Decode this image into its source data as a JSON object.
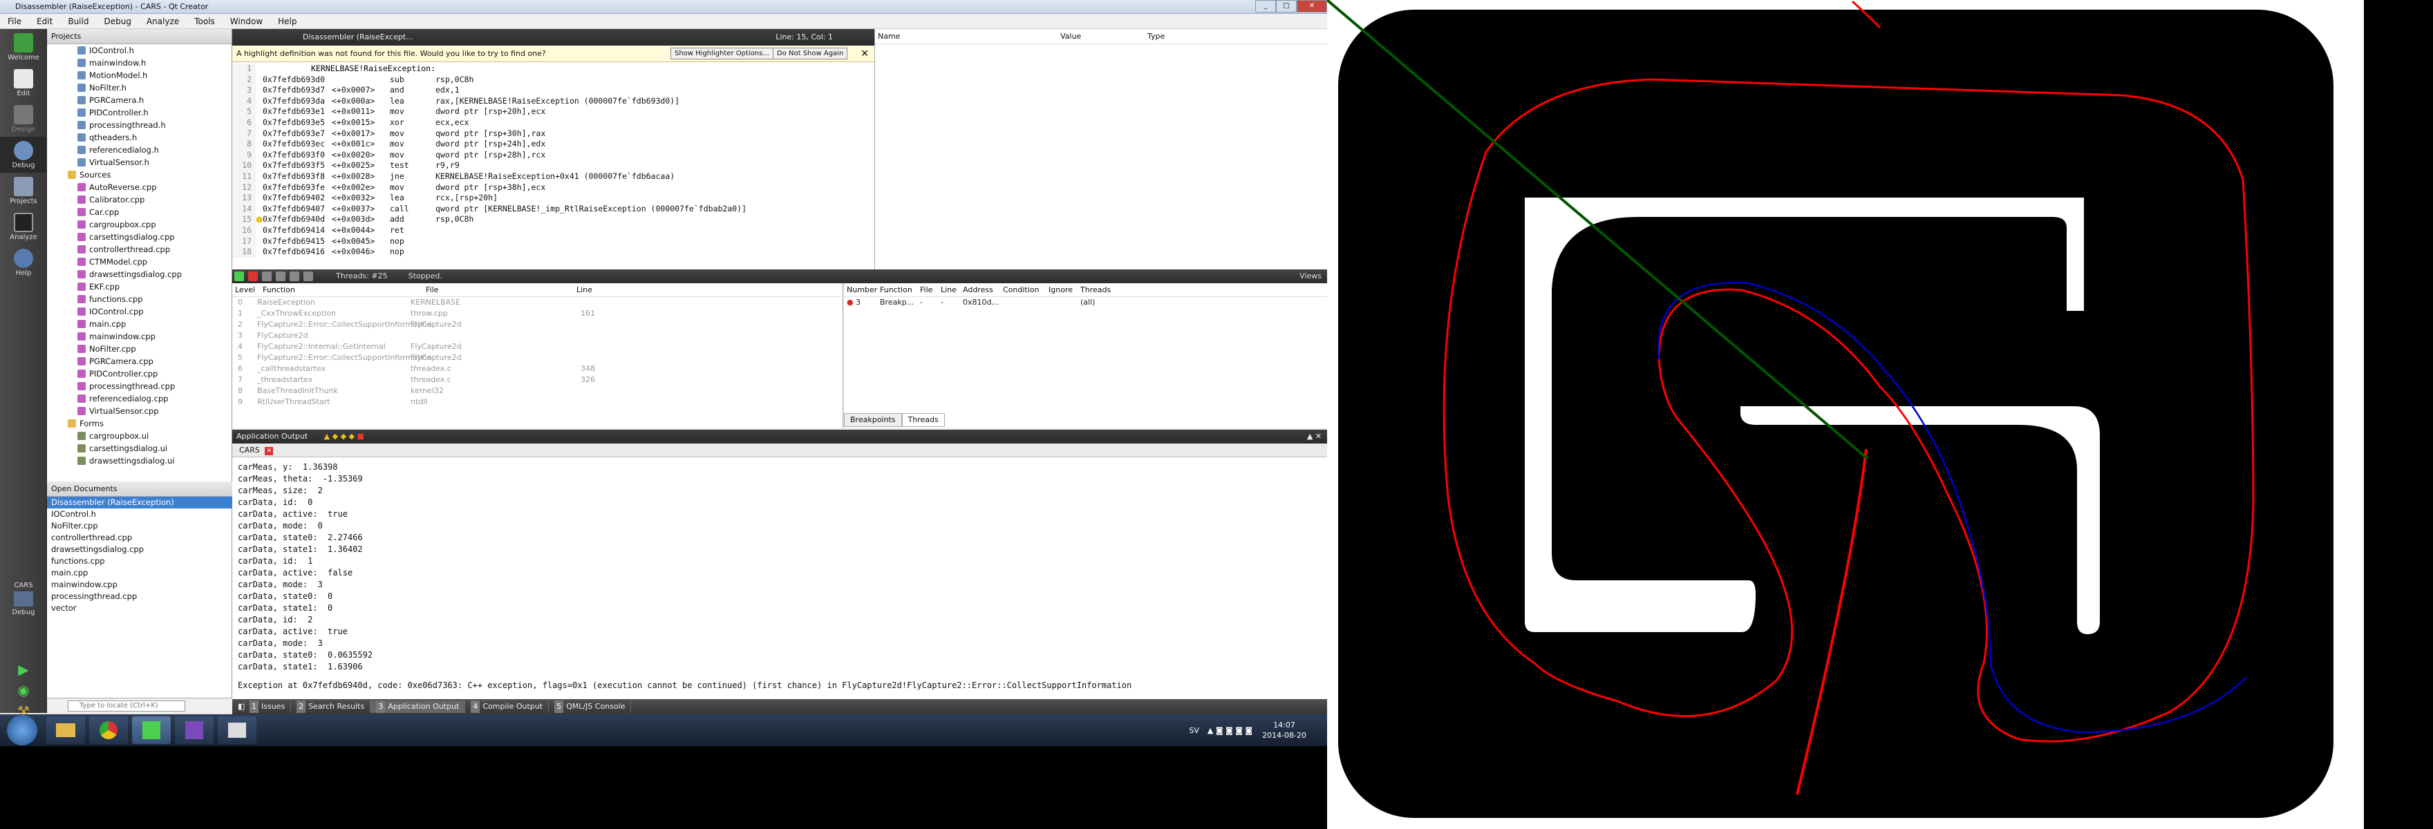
{
  "window": {
    "title": "Disassembler (RaiseException) - CARS - Qt Creator"
  },
  "menu": [
    "File",
    "Edit",
    "Build",
    "Debug",
    "Analyze",
    "Tools",
    "Window",
    "Help"
  ],
  "modes": [
    "Welcome",
    "Edit",
    "Design",
    "Debug",
    "Projects",
    "Analyze",
    "Help"
  ],
  "run_target": {
    "project": "CARS",
    "mode": "Debug"
  },
  "projects_panel": {
    "title": "Projects",
    "tree": [
      {
        "name": "IOControl.h",
        "kind": "h"
      },
      {
        "name": "mainwindow.h",
        "kind": "h"
      },
      {
        "name": "MotionModel.h",
        "kind": "h"
      },
      {
        "name": "NoFilter.h",
        "kind": "h"
      },
      {
        "name": "PGRCamera.h",
        "kind": "h"
      },
      {
        "name": "PIDController.h",
        "kind": "h"
      },
      {
        "name": "processingthread.h",
        "kind": "h"
      },
      {
        "name": "qtheaders.h",
        "kind": "h"
      },
      {
        "name": "referencedialog.h",
        "kind": "h"
      },
      {
        "name": "VirtualSensor.h",
        "kind": "h"
      },
      {
        "name": "Sources",
        "kind": "folder"
      },
      {
        "name": "AutoReverse.cpp",
        "kind": "c"
      },
      {
        "name": "Calibrator.cpp",
        "kind": "c"
      },
      {
        "name": "Car.cpp",
        "kind": "c"
      },
      {
        "name": "cargroupbox.cpp",
        "kind": "c"
      },
      {
        "name": "carsettingsdialog.cpp",
        "kind": "c"
      },
      {
        "name": "controllerthread.cpp",
        "kind": "c"
      },
      {
        "name": "CTMModel.cpp",
        "kind": "c"
      },
      {
        "name": "drawsettingsdialog.cpp",
        "kind": "c"
      },
      {
        "name": "EKF.cpp",
        "kind": "c"
      },
      {
        "name": "functions.cpp",
        "kind": "c"
      },
      {
        "name": "IOControl.cpp",
        "kind": "c"
      },
      {
        "name": "main.cpp",
        "kind": "c"
      },
      {
        "name": "mainwindow.cpp",
        "kind": "c"
      },
      {
        "name": "NoFilter.cpp",
        "kind": "c"
      },
      {
        "name": "PGRCamera.cpp",
        "kind": "c"
      },
      {
        "name": "PIDController.cpp",
        "kind": "c"
      },
      {
        "name": "processingthread.cpp",
        "kind": "c"
      },
      {
        "name": "referencedialog.cpp",
        "kind": "c"
      },
      {
        "name": "VirtualSensor.cpp",
        "kind": "c"
      },
      {
        "name": "Forms",
        "kind": "folder"
      },
      {
        "name": "cargroupbox.ui",
        "kind": "u"
      },
      {
        "name": "carsettingsdialog.ui",
        "kind": "u"
      },
      {
        "name": "drawsettingsdialog.ui",
        "kind": "u"
      }
    ]
  },
  "open_documents": {
    "title": "Open Documents",
    "items": [
      "Disassembler (RaiseException)",
      "IOControl.h",
      "NoFilter.cpp",
      "controllerthread.cpp",
      "drawsettingsdialog.cpp",
      "functions.cpp",
      "main.cpp",
      "mainwindow.cpp",
      "processingthread.cpp",
      "vector"
    ]
  },
  "locator": {
    "placeholder": "Type to locate (Ctrl+K)"
  },
  "editor": {
    "doc": "Disassembler (RaiseExcept...",
    "cursor": "Line: 15, Col: 1",
    "highlight_msg": "A highlight definition was not found for this file. Would you like to try to find one?",
    "btn_show": "Show Highlighter Options...",
    "btn_no": "Do Not Show Again",
    "label_line": "KERNELBASE!RaiseException:",
    "lines": [
      {
        "n": "2",
        "addr": "0x7fefdb693d0",
        "off": "",
        "mn": "sub",
        "op": "rsp,0C8h"
      },
      {
        "n": "3",
        "addr": "0x7fefdb693d7",
        "off": "<+0x0007>",
        "mn": "and",
        "op": "edx,1"
      },
      {
        "n": "4",
        "addr": "0x7fefdb693da",
        "off": "<+0x000a>",
        "mn": "lea",
        "op": "rax,[KERNELBASE!RaiseException (000007fe`fdb693d0)]"
      },
      {
        "n": "5",
        "addr": "0x7fefdb693e1",
        "off": "<+0x0011>",
        "mn": "mov",
        "op": "dword ptr [rsp+20h],ecx"
      },
      {
        "n": "6",
        "addr": "0x7fefdb693e5",
        "off": "<+0x0015>",
        "mn": "xor",
        "op": "ecx,ecx"
      },
      {
        "n": "7",
        "addr": "0x7fefdb693e7",
        "off": "<+0x0017>",
        "mn": "mov",
        "op": "qword ptr [rsp+30h],rax"
      },
      {
        "n": "8",
        "addr": "0x7fefdb693ec",
        "off": "<+0x001c>",
        "mn": "mov",
        "op": "dword ptr [rsp+24h],edx"
      },
      {
        "n": "9",
        "addr": "0x7fefdb693f0",
        "off": "<+0x0020>",
        "mn": "mov",
        "op": "qword ptr [rsp+28h],rcx"
      },
      {
        "n": "10",
        "addr": "0x7fefdb693f5",
        "off": "<+0x0025>",
        "mn": "test",
        "op": "r9,r9"
      },
      {
        "n": "11",
        "addr": "0x7fefdb693f8",
        "off": "<+0x0028>",
        "mn": "jne",
        "op": "KERNELBASE!RaiseException+0x41 (000007fe`fdb6acaa)"
      },
      {
        "n": "12",
        "addr": "0x7fefdb693fe",
        "off": "<+0x002e>",
        "mn": "mov",
        "op": "dword ptr [rsp+38h],ecx"
      },
      {
        "n": "13",
        "addr": "0x7fefdb69402",
        "off": "<+0x0032>",
        "mn": "lea",
        "op": "rcx,[rsp+20h]"
      },
      {
        "n": "14",
        "addr": "0x7fefdb69407",
        "off": "<+0x0037>",
        "mn": "call",
        "op": "qword ptr [KERNELBASE!_imp_RtlRaiseException (000007fe`fdbab2a0)]"
      },
      {
        "n": "15",
        "addr": "0x7fefdb6940d",
        "off": "<+0x003d>",
        "mn": "add",
        "op": "rsp,0C8h"
      },
      {
        "n": "16",
        "addr": "0x7fefdb69414",
        "off": "<+0x0044>",
        "mn": "ret",
        "op": ""
      },
      {
        "n": "17",
        "addr": "0x7fefdb69415",
        "off": "<+0x0045>",
        "mn": "nop",
        "op": ""
      },
      {
        "n": "18",
        "addr": "0x7fefdb69416",
        "off": "<+0x0046>",
        "mn": "nop",
        "op": ""
      }
    ]
  },
  "watch": {
    "cols": [
      "Name",
      "Value",
      "Type"
    ]
  },
  "debugbar": {
    "threads": "Threads: #25",
    "state": "Stopped.",
    "views": "Views"
  },
  "stack": {
    "cols": [
      "Level",
      "Function",
      "File",
      "Line"
    ],
    "rows": [
      {
        "lvl": "0",
        "fn": "RaiseException",
        "file": "KERNELBASE",
        "line": ""
      },
      {
        "lvl": "1",
        "fn": "_CxxThrowException",
        "file": "throw.cpp",
        "line": "161"
      },
      {
        "lvl": "2",
        "fn": "FlyCapture2::Error::CollectSupportInformation",
        "file": "FlyCapture2d",
        "line": ""
      },
      {
        "lvl": "3",
        "fn": "FlyCapture2d",
        "file": "",
        "line": ""
      },
      {
        "lvl": "4",
        "fn": "FlyCapture2::Internal::GetInternal",
        "file": "FlyCapture2d",
        "line": ""
      },
      {
        "lvl": "5",
        "fn": "FlyCapture2::Error::CollectSupportInformation",
        "file": "FlyCapture2d",
        "line": ""
      },
      {
        "lvl": "6",
        "fn": "_callthreadstartex",
        "file": "threadex.c",
        "line": "348"
      },
      {
        "lvl": "7",
        "fn": "_threadstartex",
        "file": "threadex.c",
        "line": "326"
      },
      {
        "lvl": "8",
        "fn": "BaseThreadInitThunk",
        "file": "kernel32",
        "line": ""
      },
      {
        "lvl": "9",
        "fn": "RtlUserThreadStart",
        "file": "ntdll",
        "line": ""
      }
    ]
  },
  "breakpoints": {
    "cols": [
      "Number",
      "Function",
      "File",
      "Line",
      "Address",
      "Condition",
      "Ignore",
      "Threads"
    ],
    "rows": [
      {
        "num": "3",
        "fn": "Breakp...",
        "file": "-",
        "line": "-",
        "addr": "0x810d...",
        "cond": "",
        "ign": "",
        "thr": "(all)"
      }
    ],
    "tabs": [
      "Breakpoints",
      "Threads"
    ]
  },
  "output": {
    "title": "Application Output",
    "tab": "CARS",
    "lines": [
      "carMeas, y:  1.36398",
      "carMeas, theta:  -1.35369",
      "carMeas, size:  2",
      "carData, id:  0",
      "carData, active:  true",
      "carData, mode:  0",
      "carData, state0:  2.27466",
      "carData, state1:  1.36402",
      "carData, id:  1",
      "carData, active:  false",
      "carData, mode:  3",
      "carData, state0:  0",
      "carData, state1:  0",
      "carData, id:  2",
      "carData, active:  true",
      "carData, mode:  3",
      "carData, state0:  0.0635592",
      "carData, state1:  1.63906"
    ],
    "exception": "Exception at 0x7fefdb6940d, code: 0xe06d7363: C++ exception, flags=0x1 (execution cannot be continued) (first chance) in FlyCapture2d!FlyCapture2::Error::CollectSupportInformation"
  },
  "bottom_tabs": [
    {
      "n": "1",
      "label": "Issues"
    },
    {
      "n": "2",
      "label": "Search Results"
    },
    {
      "n": "3",
      "label": "Application Output"
    },
    {
      "n": "4",
      "label": "Compile Output"
    },
    {
      "n": "5",
      "label": "QML/JS Console"
    }
  ],
  "taskbar": {
    "lang": "SV",
    "time": "14:07",
    "date": "2014-08-20"
  },
  "colors": {
    "accent": "#3b7fd1",
    "track": "#000000",
    "ref_path": "#ff0000",
    "car_path": "#0000cc",
    "ray": "#005500"
  }
}
